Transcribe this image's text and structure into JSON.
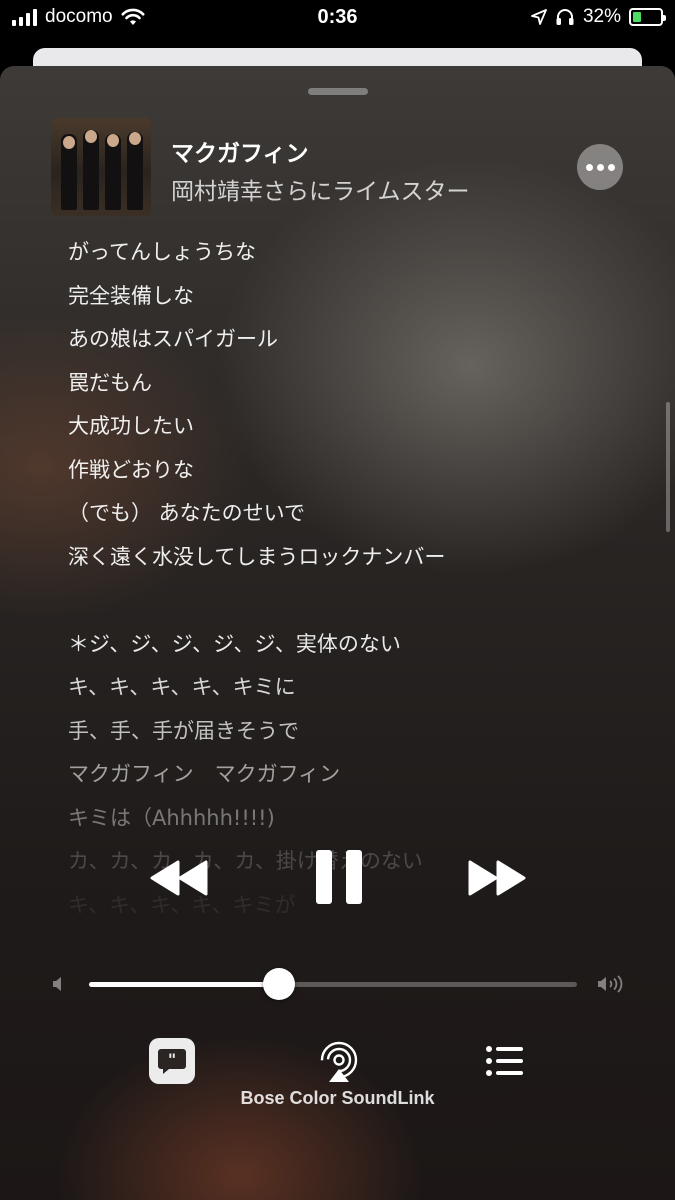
{
  "status_bar": {
    "carrier": "docomo",
    "time": "0:36",
    "battery_percent": "32%",
    "battery_level": 0.32,
    "icons": [
      "signal-icon",
      "wifi-icon",
      "location-icon",
      "headphones-icon",
      "battery-icon"
    ]
  },
  "now_playing": {
    "title": "マクガフィン",
    "artist": "岡村靖幸さらにライムスター"
  },
  "lyrics": [
    {
      "text": "がってんしょうちな",
      "opacity": 0.92
    },
    {
      "text": "完全装備しな",
      "opacity": 0.92
    },
    {
      "text": "あの娘はスパイガール",
      "opacity": 0.92
    },
    {
      "text": "罠だもん",
      "opacity": 0.92
    },
    {
      "text": "大成功したい",
      "opacity": 0.92
    },
    {
      "text": "作戦どおりな",
      "opacity": 0.92
    },
    {
      "text": "（でも） あなたのせいで",
      "opacity": 0.92
    },
    {
      "text": "深く遠く水没してしまうロックナンバー",
      "opacity": 0.92
    },
    {
      "text": "",
      "opacity": 0.0
    },
    {
      "text": "＊ジ、ジ、ジ、ジ、ジ、実体のない",
      "opacity": 0.9
    },
    {
      "text": " キ、キ、キ、キ、キミに",
      "opacity": 0.82
    },
    {
      "text": " 手、手、手が届きそうで",
      "opacity": 0.72
    },
    {
      "text": " マクガフィン　マクガフィン",
      "opacity": 0.58
    },
    {
      "text": " キミは（Ahhhhh!!!!)",
      "opacity": 0.4
    },
    {
      "text": " カ、カ、カ、カ、カ、掛け替えのない",
      "opacity": 0.2
    },
    {
      "text": " キ、キ、キ、キ、キミが",
      "opacity": 0.08
    }
  ],
  "volume": {
    "level": 0.39
  },
  "bottom_bar": {
    "device_label": "Bose Color SoundLink"
  },
  "colors": {
    "battery_fill": "#4cd964",
    "lyrics_button_bg": "#ececec"
  }
}
